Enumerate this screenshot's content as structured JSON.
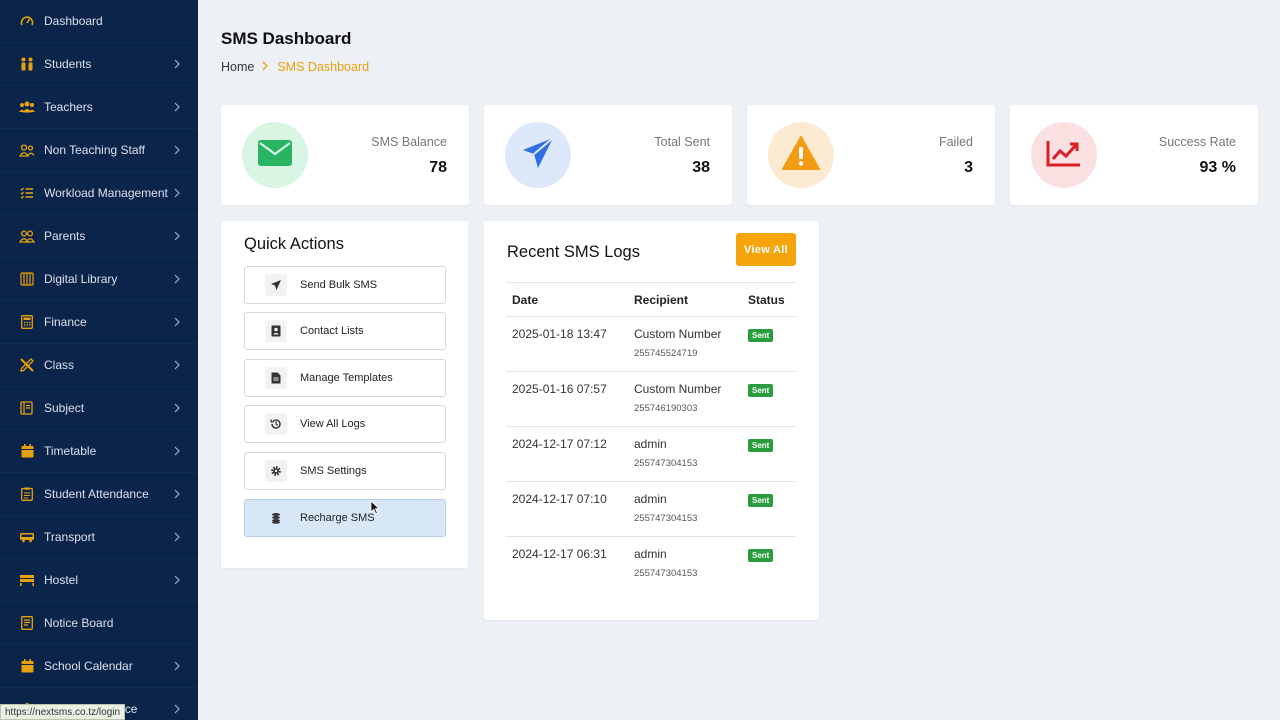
{
  "sidebar": {
    "items": [
      {
        "label": "Dashboard",
        "icon": "gauge-icon",
        "chevron": false
      },
      {
        "label": "Students",
        "icon": "students-icon",
        "chevron": true
      },
      {
        "label": "Teachers",
        "icon": "teachers-icon",
        "chevron": true
      },
      {
        "label": "Non Teaching Staff",
        "icon": "staff-icon",
        "chevron": true
      },
      {
        "label": "Workload Management",
        "icon": "list-check-icon",
        "chevron": true
      },
      {
        "label": "Parents",
        "icon": "parents-icon",
        "chevron": true
      },
      {
        "label": "Digital Library",
        "icon": "library-icon",
        "chevron": true
      },
      {
        "label": "Finance",
        "icon": "calculator-icon",
        "chevron": true
      },
      {
        "label": "Class",
        "icon": "pencil-ruler-icon",
        "chevron": true
      },
      {
        "label": "Subject",
        "icon": "book-icon",
        "chevron": true
      },
      {
        "label": "Timetable",
        "icon": "calendar-icon",
        "chevron": true
      },
      {
        "label": "Student Attendance",
        "icon": "clipboard-icon",
        "chevron": true
      },
      {
        "label": "Transport",
        "icon": "bus-icon",
        "chevron": true
      },
      {
        "label": "Hostel",
        "icon": "bed-icon",
        "chevron": true
      },
      {
        "label": "Notice Board",
        "icon": "notice-icon",
        "chevron": false
      },
      {
        "label": "School Calendar",
        "icon": "calendar-icon",
        "chevron": true
      },
      {
        "label": "Human Resource",
        "icon": "hr-icon",
        "chevron": true
      }
    ]
  },
  "status_url": "https://nextsms.co.tz/login",
  "header": {
    "title": "SMS Dashboard",
    "breadcrumb_home": "Home",
    "breadcrumb_current": "SMS Dashboard"
  },
  "stats": [
    {
      "label": "SMS Balance",
      "value": "78",
      "icon": "envelope-icon",
      "bg": "#d9f5e3",
      "color": "#28b463"
    },
    {
      "label": "Total Sent",
      "value": "38",
      "icon": "paper-plane-icon",
      "bg": "#dde9fb",
      "color": "#2f6fe0"
    },
    {
      "label": "Failed",
      "value": "3",
      "icon": "warning-icon",
      "bg": "#fcebd2",
      "color": "#f39c12"
    },
    {
      "label": "Success Rate",
      "value": "93 %",
      "icon": "chart-line-icon",
      "bg": "#fbe0e2",
      "color": "#d91f26"
    }
  ],
  "quick_actions": {
    "title": "Quick Actions",
    "items": [
      {
        "label": "Send Bulk SMS",
        "icon": "paper-plane-icon"
      },
      {
        "label": "Contact Lists",
        "icon": "address-book-icon"
      },
      {
        "label": "Manage Templates",
        "icon": "file-icon"
      },
      {
        "label": "View All Logs",
        "icon": "history-icon"
      },
      {
        "label": "SMS Settings",
        "icon": "gear-icon"
      },
      {
        "label": "Recharge SMS",
        "icon": "coins-icon"
      }
    ]
  },
  "logs": {
    "title": "Recent SMS Logs",
    "view_all": "View All",
    "columns": [
      "Date",
      "Recipient",
      "Status"
    ],
    "rows": [
      {
        "date": "2025-01-18 13:47",
        "recipient": "Custom Number",
        "number": "255745524719",
        "status": "Sent"
      },
      {
        "date": "2025-01-16 07:57",
        "recipient": "Custom Number",
        "number": "255746190303",
        "status": "Sent"
      },
      {
        "date": "2024-12-17 07:12",
        "recipient": "admin",
        "number": "255747304153",
        "status": "Sent"
      },
      {
        "date": "2024-12-17 07:10",
        "recipient": "admin",
        "number": "255747304153",
        "status": "Sent"
      },
      {
        "date": "2024-12-17 06:31",
        "recipient": "admin",
        "number": "255747304153",
        "status": "Sent"
      }
    ]
  },
  "colors": {
    "sidebar_bg": "#0b2449",
    "accent": "#f5a50b",
    "sent_badge": "#2a9d3f"
  }
}
